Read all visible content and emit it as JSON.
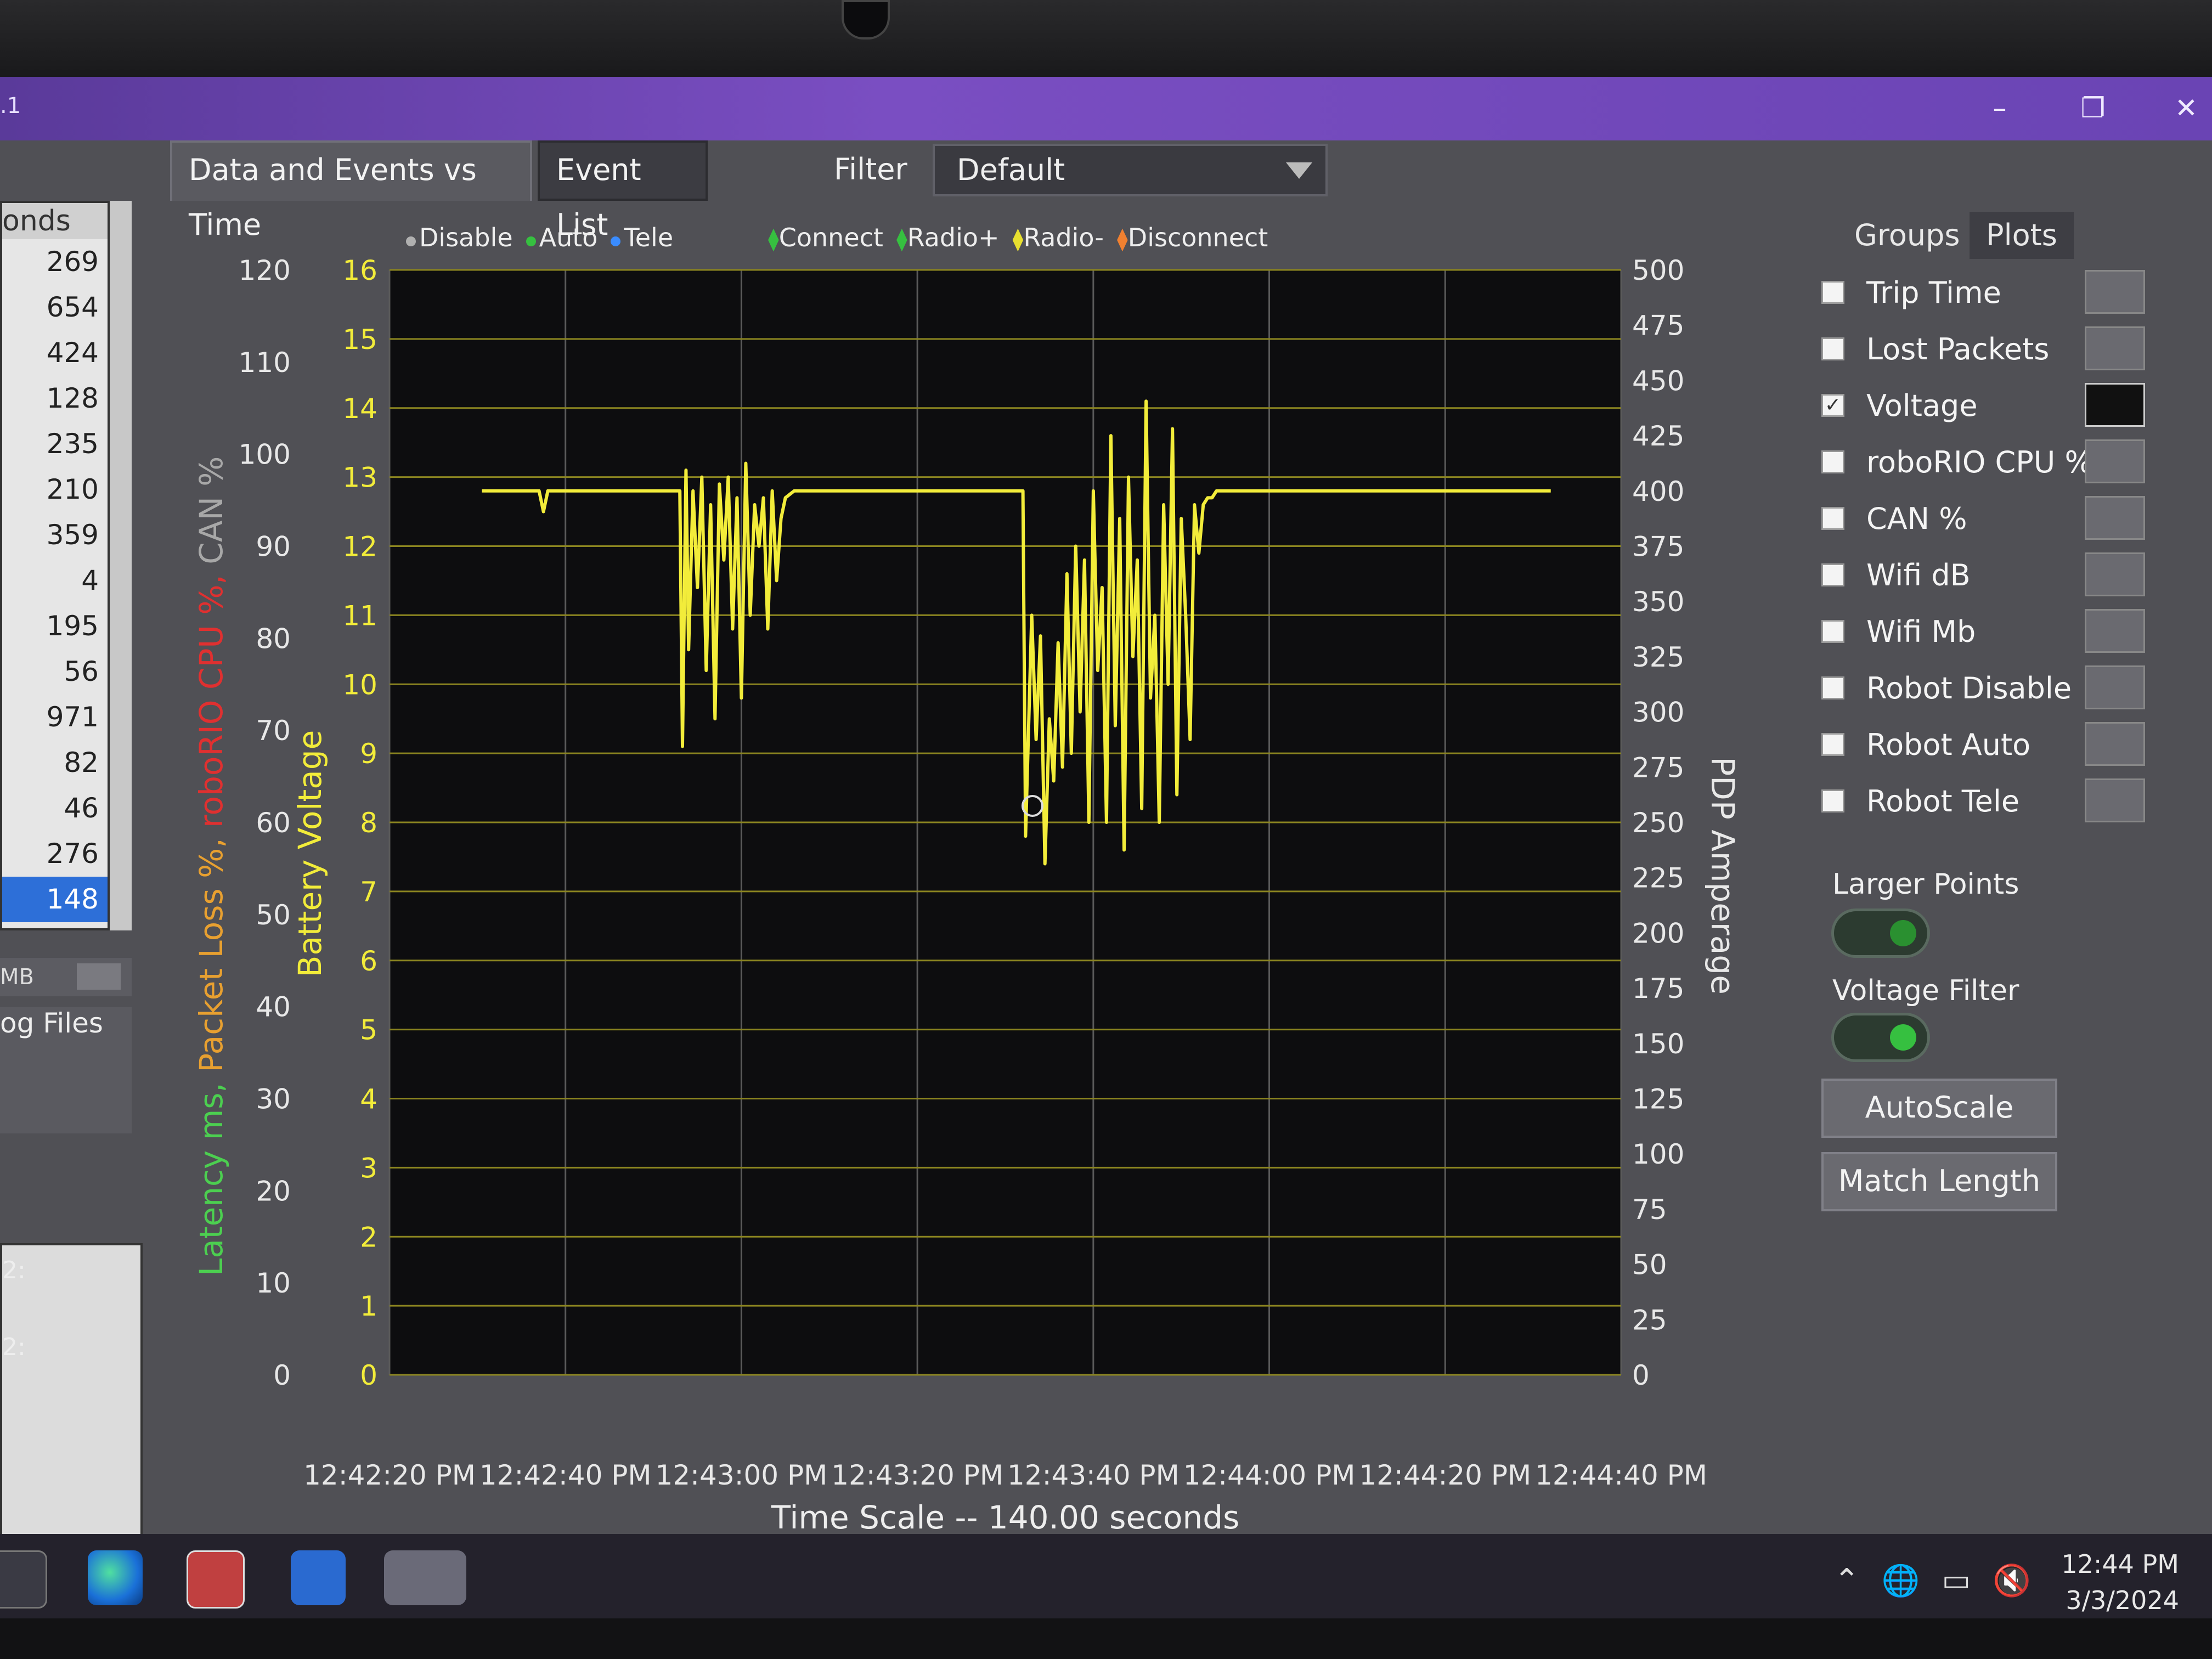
{
  "window": {
    "title_fragment": ".1",
    "min_icon": "minimize-icon",
    "restore_icon": "restore-icon",
    "close_icon": "close-icon"
  },
  "tabs": {
    "data_events": "Data and Events vs Time",
    "event_list": "Event List",
    "filter_label": "Filter",
    "filter_value": "Default"
  },
  "left": {
    "list_header": "onds",
    "list_values": [
      "269",
      "654",
      "424",
      "128",
      "235",
      "210",
      "359",
      "4",
      "195",
      "56",
      "971",
      "82",
      "46",
      "276",
      "148"
    ],
    "selected_index": 14,
    "mb_label": "MB",
    "log_files": "og Files",
    "lower_labels": [
      "2:",
      "2:"
    ]
  },
  "legend": {
    "modes": [
      {
        "label": "Disable",
        "color": "#b0b0b0"
      },
      {
        "label": "Auto",
        "color": "#36c040"
      },
      {
        "label": "Tele",
        "color": "#3a8cff"
      }
    ],
    "events": [
      {
        "label": "Connect",
        "color": "#36c040"
      },
      {
        "label": "Radio+",
        "color": "#36c040"
      },
      {
        "label": "Radio-",
        "color": "#e8e030"
      },
      {
        "label": "Disconnect",
        "color": "#f08030"
      }
    ]
  },
  "axes": {
    "left_title_parts": [
      {
        "text": "Latency ms,",
        "color": "#4ccf50"
      },
      {
        "text": " Packet Loss %,",
        "color": "#e8a030"
      },
      {
        "text": " roboRIO CPU %,",
        "color": "#e03030"
      },
      {
        "text": " CAN %",
        "color": "#a8a8a8"
      }
    ],
    "voltage_title": "Battery Voltage",
    "amperage_title": "PDP Amperage",
    "time_scale": "Time Scale -- 140.00 seconds"
  },
  "chart_data": {
    "type": "line",
    "title": "",
    "xlabel": "Time Scale -- 140.00 seconds",
    "ylabel": "Battery Voltage",
    "x_tick_labels": [
      "12:42:20 PM",
      "12:42:40 PM",
      "12:43:00 PM",
      "12:43:20 PM",
      "12:43:40 PM",
      "12:44:00 PM",
      "12:44:20 PM",
      "12:44:40 PM"
    ],
    "xlim_seconds": [
      0,
      140
    ],
    "ylim": [
      0,
      16
    ],
    "y_left_percent_ticks": [
      "0",
      "10",
      "20",
      "30",
      "40",
      "50",
      "60",
      "70",
      "80",
      "90",
      "100",
      "110",
      "120"
    ],
    "y_voltage_ticks": [
      "0",
      "1",
      "2",
      "3",
      "4",
      "5",
      "6",
      "7",
      "8",
      "9",
      "10",
      "11",
      "12",
      "13",
      "14",
      "15",
      "16"
    ],
    "y_amperage_ticks": [
      "0",
      "25",
      "50",
      "75",
      "100",
      "125",
      "150",
      "175",
      "200",
      "225",
      "250",
      "275",
      "300",
      "325",
      "350",
      "375",
      "400",
      "425",
      "450",
      "475",
      "500"
    ],
    "grid": true,
    "series": [
      {
        "name": "Voltage",
        "color": "#f2ec3a",
        "x": [
          10.5,
          17,
          17.5,
          18,
          30,
          33,
          33.3,
          33.7,
          34,
          34.5,
          35,
          35.5,
          36,
          36.5,
          37,
          37.5,
          38,
          38.5,
          39,
          39.5,
          40,
          40.5,
          41,
          41.5,
          42,
          42.5,
          43,
          43.5,
          44,
          44.5,
          45,
          46,
          50,
          55,
          60,
          70,
          72,
          72.3,
          73,
          73.5,
          74,
          74.5,
          75,
          75.5,
          76,
          76.5,
          77,
          77.5,
          78,
          78.5,
          79,
          79.5,
          80,
          80.5,
          81,
          81.5,
          82,
          82.5,
          83,
          83.5,
          84,
          84.5,
          85,
          85.5,
          86,
          86.5,
          87,
          87.5,
          88,
          88.5,
          89,
          89.5,
          90,
          90.5,
          91,
          91.5,
          92,
          92.5,
          93,
          93.5,
          94,
          94.5,
          95,
          96,
          100,
          110,
          120,
          132
        ],
        "y": [
          12.8,
          12.8,
          12.5,
          12.8,
          12.8,
          12.8,
          9.1,
          13.1,
          10.5,
          12.8,
          11.4,
          13.0,
          10.2,
          12.6,
          9.5,
          12.9,
          11.8,
          13.0,
          10.8,
          12.7,
          9.8,
          13.2,
          11.0,
          12.6,
          12.0,
          12.7,
          10.8,
          12.8,
          11.5,
          12.4,
          12.7,
          12.8,
          12.8,
          12.8,
          12.8,
          12.8,
          12.8,
          7.8,
          11.0,
          9.2,
          10.7,
          7.4,
          9.5,
          8.6,
          10.6,
          8.8,
          11.6,
          9.0,
          12.0,
          9.6,
          11.8,
          8.0,
          12.8,
          10.2,
          11.4,
          8.0,
          13.6,
          9.4,
          12.4,
          7.6,
          13.0,
          10.4,
          11.8,
          8.2,
          14.1,
          9.8,
          11.0,
          8.0,
          12.6,
          10.0,
          13.7,
          8.4,
          12.4,
          11.0,
          9.2,
          12.6,
          11.9,
          12.6,
          12.7,
          12.7,
          12.8,
          12.8,
          12.8,
          12.8,
          12.8,
          12.8,
          12.8,
          12.8
        ]
      }
    ]
  },
  "right": {
    "groups_tab": "Groups",
    "plots_tab": "Plots",
    "plots": [
      {
        "label": "Trip Time",
        "checked": false
      },
      {
        "label": "Lost Packets",
        "checked": false
      },
      {
        "label": "Voltage",
        "checked": true
      },
      {
        "label": "roboRIO CPU %",
        "checked": false
      },
      {
        "label": "CAN %",
        "checked": false
      },
      {
        "label": "Wifi dB",
        "checked": false
      },
      {
        "label": "Wifi Mb",
        "checked": false
      },
      {
        "label": "Robot Disable",
        "checked": false
      },
      {
        "label": "Robot Auto",
        "checked": false
      },
      {
        "label": "Robot Tele",
        "checked": false
      }
    ],
    "larger_points": "Larger Points",
    "voltage_filter": "Voltage Filter",
    "autoscale": "AutoScale",
    "match_length": "Match Length"
  },
  "taskbar": {
    "time": "12:44 PM",
    "date": "3/3/2024",
    "icons": [
      "terminal-icon",
      "edge-icon",
      "app-icon",
      "microscope-icon",
      "driver-station-icon"
    ],
    "tray_icons": [
      "chevron-up-icon",
      "globe-icon",
      "battery-icon",
      "mute-icon"
    ]
  }
}
